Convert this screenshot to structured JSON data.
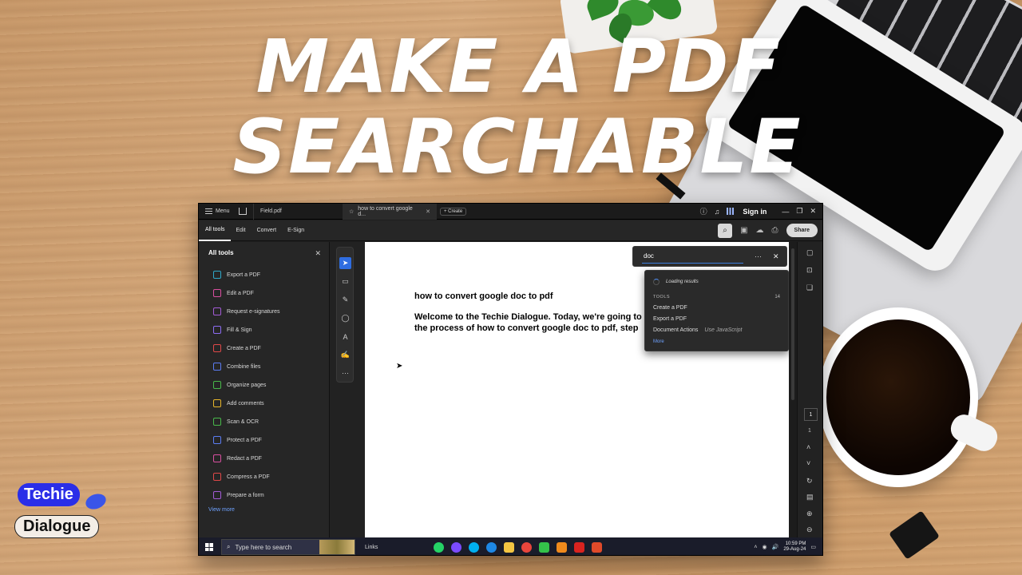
{
  "headline": {
    "line1": "MAKE A PDF",
    "line2": "SEARCHABLE"
  },
  "brand": {
    "word1": "Techie",
    "word2": "Dialogue"
  },
  "window": {
    "menu_label": "Menu",
    "tabs": [
      {
        "label": "Field.pdf"
      },
      {
        "label": "how to convert google d..."
      }
    ],
    "create_label": "Create",
    "sign_in": "Sign in"
  },
  "toolbar": {
    "tabs": [
      "All tools",
      "Edit",
      "Convert",
      "E-Sign"
    ],
    "share_label": "Share"
  },
  "side_panel": {
    "title": "All tools",
    "items": [
      {
        "label": "Export a PDF",
        "color": "#2fa8c9"
      },
      {
        "label": "Edit a PDF",
        "color": "#d94fa0"
      },
      {
        "label": "Request e-signatures",
        "color": "#a35bd6"
      },
      {
        "label": "Fill & Sign",
        "color": "#8c6cf2"
      },
      {
        "label": "Create a PDF",
        "color": "#e04848"
      },
      {
        "label": "Combine files",
        "color": "#5b7cf2"
      },
      {
        "label": "Organize pages",
        "color": "#48b84a"
      },
      {
        "label": "Add comments",
        "color": "#e8b62b"
      },
      {
        "label": "Scan & OCR",
        "color": "#48b84a"
      },
      {
        "label": "Protect a PDF",
        "color": "#5b7cf2"
      },
      {
        "label": "Redact a PDF",
        "color": "#d94fa0"
      },
      {
        "label": "Compress a PDF",
        "color": "#e04848"
      },
      {
        "label": "Prepare a form",
        "color": "#a35bd6"
      }
    ],
    "view_more": "View more"
  },
  "document": {
    "title": "how to convert google doc to pdf",
    "para_line1": "Welcome to the Techie Dialogue. Today, we're going to",
    "para_line2": "the process of how to convert google doc to pdf, step"
  },
  "search": {
    "value": "doc",
    "loading": "Loading results",
    "section": "TOOLS",
    "count": "14",
    "results": [
      {
        "label": "Create a PDF"
      },
      {
        "label": "Export a PDF"
      },
      {
        "label": "Document Actions",
        "hint": "Use JavaScript"
      }
    ],
    "more": "More"
  },
  "page_nav": {
    "current": "1",
    "total": "1"
  },
  "taskbar": {
    "search_placeholder": "Type here to search",
    "links_label": "Links",
    "time": "10:59 PM",
    "date": "29-Aug-24"
  },
  "colors": {
    "accent_blue": "#2f6de1",
    "app_bg": "#1f1f1f",
    "brand_blue": "#2a2ee8"
  }
}
